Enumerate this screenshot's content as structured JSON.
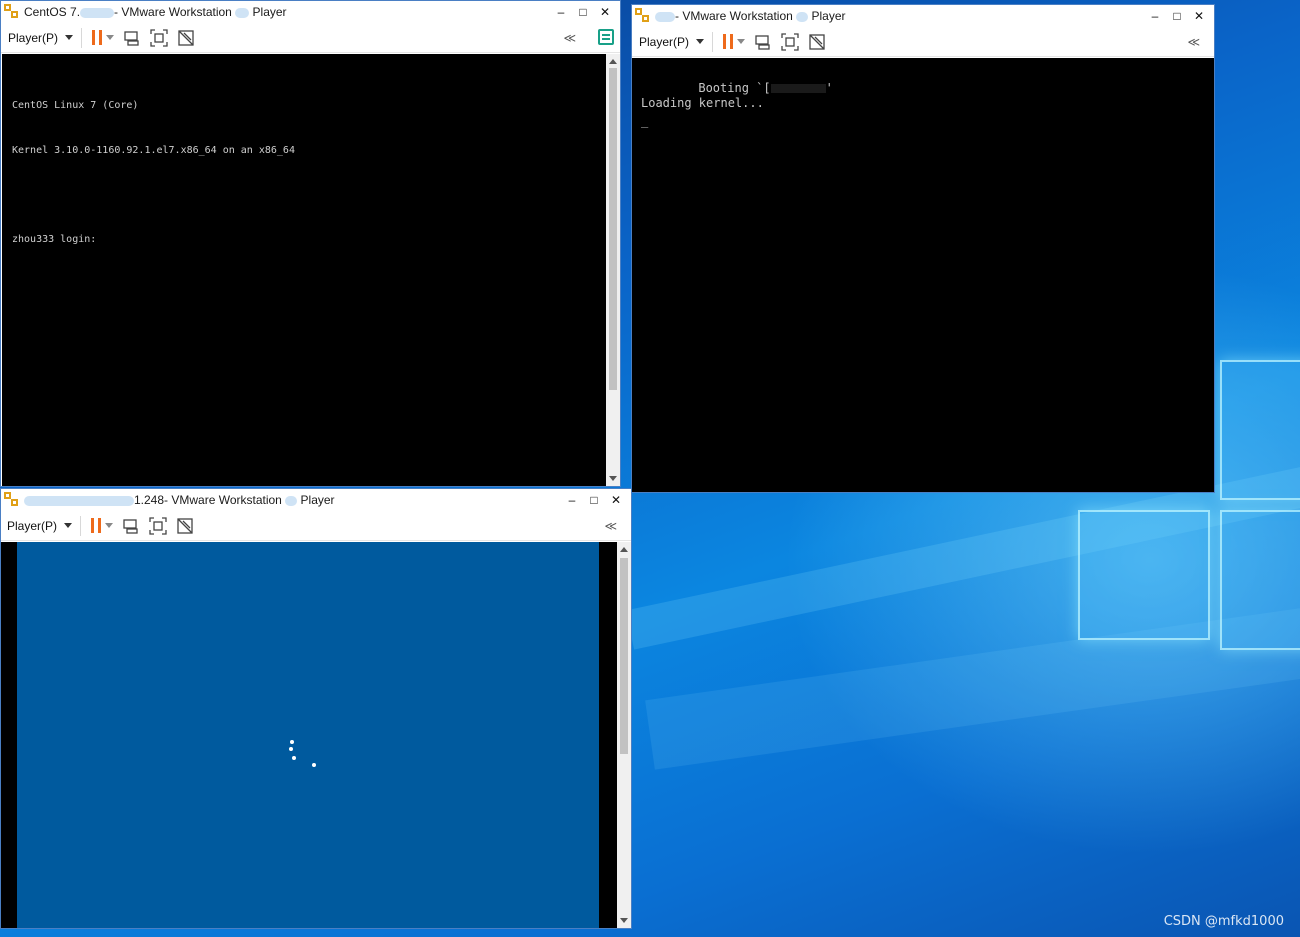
{
  "desktop": {
    "watermark": "CSDN @mfkd1000"
  },
  "windows": {
    "centos": {
      "title_prefix": "CentOS 7.",
      "title_mid": "- VMware Workstation",
      "title_suffix": "Player",
      "menu_label": "Player(P)",
      "console_lines": [
        "CentOS Linux 7 (Core)",
        "Kernel 3.10.0-1160.92.1.el7.x86_64 on an x86_64",
        "",
        "zhou333 login:"
      ]
    },
    "booting": {
      "title_prefix": "",
      "title_mid": "- VMware Workstation",
      "title_suffix": "Player",
      "menu_label": "Player(P)",
      "boot_line": "Booting `[",
      "boot_line_end": "'",
      "loading_line": "Loading kernel...",
      "cursor": "_"
    },
    "windows_vm": {
      "title_prefix": "1.248- VMware Workstation",
      "title_suffix": "Player",
      "menu_label": "Player(P)"
    }
  },
  "controls": {
    "minimize": "–",
    "maximize": "□",
    "close": "✕",
    "collapse": "≪"
  },
  "icons": [
    "vmware-icon",
    "pause-icon",
    "send-ctrl-alt-del-icon",
    "fullscreen-icon",
    "unity-icon",
    "notes-icon"
  ],
  "colors": {
    "pause": "#ee6a1b",
    "win_boot_bg": "#005a9e",
    "icon_gold": "#e0a017"
  }
}
